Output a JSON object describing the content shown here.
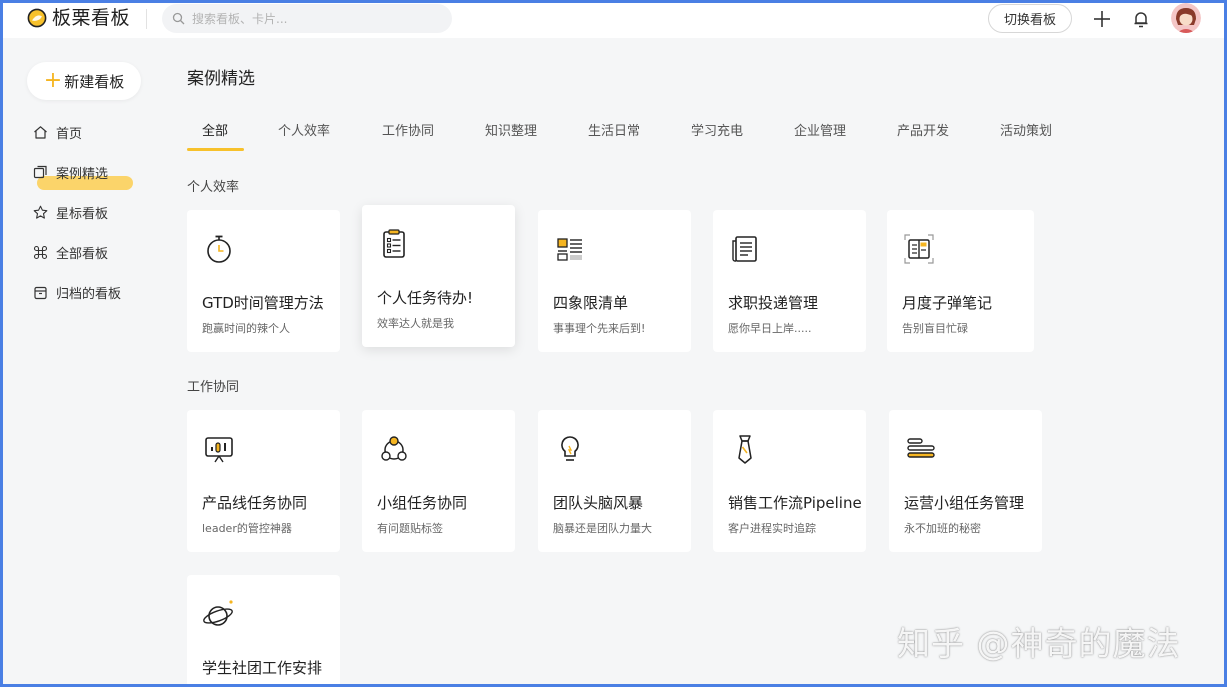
{
  "app": {
    "name": "板栗看板"
  },
  "search": {
    "placeholder": "搜索看板、卡片..."
  },
  "header": {
    "switch_label": "切换看板"
  },
  "sidebar": {
    "new_board_label": "新建看板",
    "items": [
      {
        "label": "首页",
        "icon": "home-icon"
      },
      {
        "label": "案例精选",
        "icon": "copy-icon",
        "active": true
      },
      {
        "label": "星标看板",
        "icon": "star-icon"
      },
      {
        "label": "全部看板",
        "icon": "command-icon"
      },
      {
        "label": "归档的看板",
        "icon": "archive-icon"
      }
    ]
  },
  "main": {
    "title": "案例精选",
    "tabs": [
      "全部",
      "个人效率",
      "工作协同",
      "知识整理",
      "生活日常",
      "学习充电",
      "企业管理",
      "产品开发",
      "活动策划"
    ],
    "active_tab": "全部",
    "sections": [
      {
        "title": "个人效率",
        "cards": [
          {
            "title": "GTD时间管理方法",
            "subtitle": "跑赢时间的辣个人",
            "icon": "stopwatch-icon"
          },
          {
            "title": "个人任务待办!",
            "subtitle": "效率达人就是我",
            "icon": "clipboard-list-icon"
          },
          {
            "title": "四象限清单",
            "subtitle": "事事理个先来后到!",
            "icon": "quadrant-list-icon"
          },
          {
            "title": "求职投递管理",
            "subtitle": "愿你早日上岸.....",
            "icon": "newspaper-icon"
          },
          {
            "title": "月度子弹笔记",
            "subtitle": "告别盲目忙碌",
            "icon": "notebook-icon"
          }
        ]
      },
      {
        "title": "工作协同",
        "cards": [
          {
            "title": "产品线任务协同",
            "subtitle": "leader的管控神器",
            "icon": "presentation-chart-icon"
          },
          {
            "title": "小组任务协同",
            "subtitle": "有问题贴标签",
            "icon": "team-circle-icon"
          },
          {
            "title": "团队头脑风暴",
            "subtitle": "脑暴还是团队力量大",
            "icon": "lightbulb-icon"
          },
          {
            "title": "销售工作流Pipeline",
            "subtitle": "客户进程实时追踪",
            "icon": "necktie-icon"
          },
          {
            "title": "运营小组任务管理",
            "subtitle": "永不加班的秘密",
            "icon": "bars-icon"
          }
        ]
      },
      {
        "title": "",
        "cards": [
          {
            "title": "学生社团工作安排",
            "subtitle": "",
            "icon": "planet-icon"
          }
        ]
      }
    ]
  },
  "watermark": "知乎 @神奇的魔法",
  "colors": {
    "accent": "#f7c12b",
    "highlight": "#fbd46a",
    "frame": "#4a7fe4"
  }
}
